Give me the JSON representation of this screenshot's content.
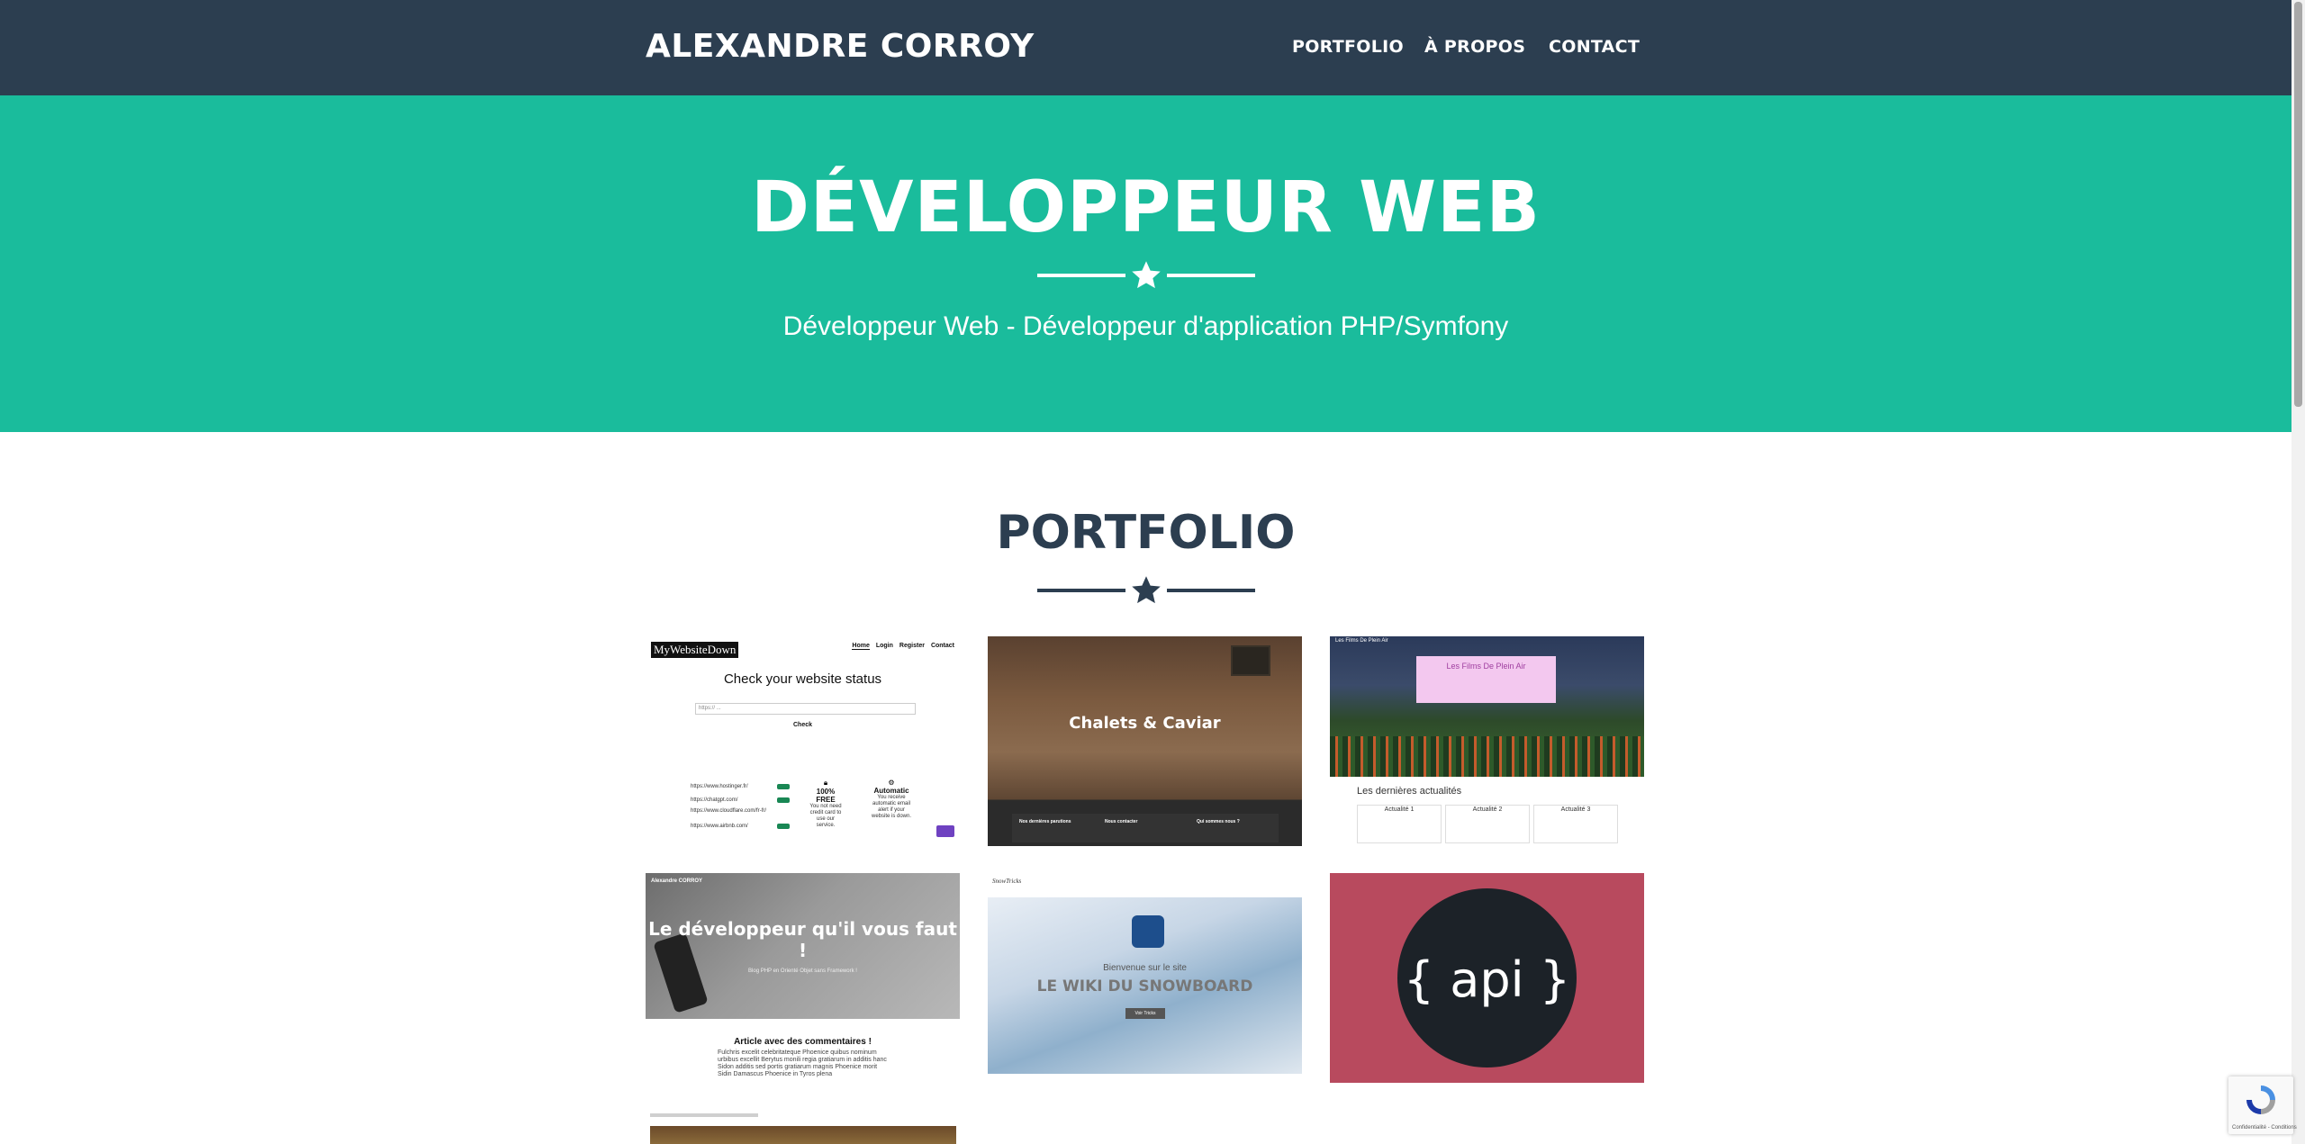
{
  "navbar": {
    "brand": "ALEXANDRE CORROY",
    "links": [
      "PORTFOLIO",
      "À PROPOS",
      "CONTACT"
    ]
  },
  "masthead": {
    "title": "DÉVELOPPEUR WEB",
    "subtitle": "Développeur Web - Développeur d'application PHP/Symfony"
  },
  "portfolio": {
    "title": "PORTFOLIO",
    "items": [
      {
        "logo": "MyWebsiteDown",
        "nav": [
          "Home",
          "Login",
          "Register",
          "Contact"
        ],
        "heading": "Check your website status",
        "placeholder": "https:// ...",
        "button": "Check",
        "urls": [
          "https://www.hostinger.fr/",
          "https://chatgpt.com/",
          "https://www.cloudflare.com/fr-fr/",
          "https://www.airbnb.com/"
        ],
        "feature1_title": "100% FREE",
        "feature1_text": "You not need credit card to use our service.",
        "feature2_title": "Automatic",
        "feature2_text": "You receive automatic email alert if your website is down."
      },
      {
        "title": "Chalets & Caviar",
        "footer": [
          "Nos dernières parutions",
          "Nous contacter",
          "Qui sommes nous ?"
        ]
      },
      {
        "site_title": "Les Films De Plein Air",
        "banner": "Les Films De Plein Air",
        "section": "Les dernières actualités",
        "news": [
          "Actualité 1",
          "Actualité 2",
          "Actualité 3"
        ]
      },
      {
        "brand": "Alexandre CORROY",
        "headline": "Le développeur qu'il vous faut !",
        "tagline": "Blog PHP en Orienté Objet sans Framework !",
        "article_title": "Article avec des commentaires !",
        "article_text": "Fulchris excelit celebritateque Phoenice quibus nominum urbibus excellit Berytus monili regia gratiarum in additis hanc Sidon additis sed portis gratiarum magnis Phoenice morit Sidin Damascus Phoenice in Tyros plena"
      },
      {
        "logo": "SnowTricks",
        "overline": "Bienvenue sur le site",
        "headline": "LE WIKI DU SNOWBOARD",
        "button": "Voir Tricks"
      },
      {
        "label": "{ api }"
      }
    ]
  },
  "recaptcha": {
    "text": "Confidentialité - Conditions"
  },
  "colors": {
    "primary": "#2c3e50",
    "secondary": "#1abc9c",
    "api_bg": "#b84a5e"
  }
}
